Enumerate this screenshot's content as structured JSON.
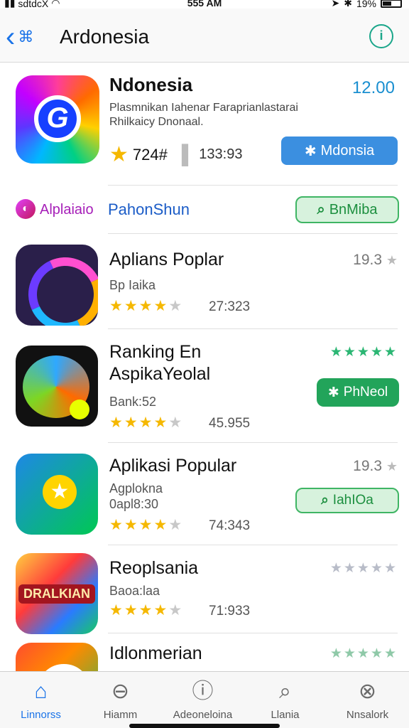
{
  "status": {
    "carrier": "sdtdcX",
    "time": "555 AM",
    "battery": "19%"
  },
  "nav": {
    "title": "Ardonesia",
    "back_label": "‹ ⌘"
  },
  "hero": {
    "title": "Ndonesia",
    "price": "12.00",
    "desc_line1": "Plasmnikan Iahenar Faraprianlastarai",
    "desc_line2": "Rhilkaicy Dnonaal.",
    "rating": "724#",
    "count": "133:93",
    "button_label": "Mdonsia"
  },
  "category": {
    "label1": "Alplaiaio",
    "label2": "PahonShun",
    "button_label": "BnMiba"
  },
  "apps": [
    {
      "title": "Aplians Poplar",
      "sub": "Bp Iaika",
      "stars": "★★★★",
      "stars_empty": "★",
      "count": "27:323",
      "score": "19.3"
    },
    {
      "title_line1": "Ranking En",
      "title_line2": "AspikaYeolal",
      "sub": "Bank:52",
      "stars": "★★★★",
      "stars_empty": "★",
      "count": "45.955",
      "mini_stars": "★★★★★",
      "button_label": "PhNeol"
    },
    {
      "title": "Aplikasi Popular",
      "sub_line1": "Agplokna",
      "sub_line2": "0apl8:30",
      "stars": "★★★★",
      "stars_empty": "★",
      "count": "74:343",
      "score": "19.3",
      "button_label": "IahIOa"
    },
    {
      "title": "Reoplsania",
      "sub": "Baoa:laa",
      "stars": "★★★★",
      "stars_empty": "★",
      "count": "71:933",
      "mini_stars": "★★★★★"
    },
    {
      "title": "Idlonmerian",
      "mini_stars": "★★★★★"
    }
  ],
  "tabs": [
    {
      "label": "Linnorss",
      "icon": "home-icon"
    },
    {
      "label": "Hiamm",
      "icon": "search-minus-icon"
    },
    {
      "label": "Adeoneloina",
      "icon": "info-box-icon"
    },
    {
      "label": "Llania",
      "icon": "search-icon"
    },
    {
      "label": "Nnsalork",
      "icon": "profile-icon"
    }
  ],
  "colors": {
    "accent": "#1a73e8",
    "green": "#22a45a",
    "star": "#f5b800",
    "hero_button": "#3b8fe0"
  }
}
